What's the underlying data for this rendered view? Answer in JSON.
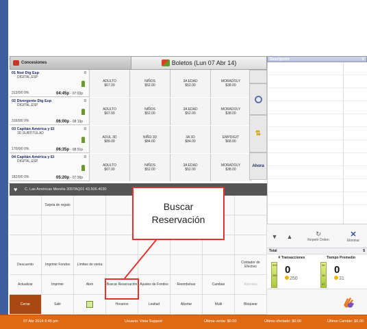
{
  "header": {
    "concessions_tab": "Concesiones",
    "tickets_title": "Boletos (Lun 07 Abr 14)"
  },
  "movies": [
    {
      "title": "01 Noé Dig Esp",
      "count": "0",
      "format": "DIGITAL,ESP",
      "seats": "313/0/0  0%",
      "time": "04:45p",
      "end_time": "- 07:03p",
      "prices": [
        {
          "label": "ADULTO",
          "value": "$67.00"
        },
        {
          "label": "NIÑOS",
          "value": "$52.00"
        },
        {
          "label": "3A EDAD",
          "value": "$52.00"
        },
        {
          "label": "MORADOLY",
          "value": "$38.00"
        }
      ]
    },
    {
      "title": "02 Divergente Dig Esp",
      "count": "0",
      "format": "DIGITAL,ESP",
      "seats": "316/0/0  0%",
      "time": "06:00p",
      "end_time": "- 08:19p",
      "prices": [
        {
          "label": "ADULTO",
          "value": "$67.00"
        },
        {
          "label": "NIÑOS",
          "value": "$52.00"
        },
        {
          "label": "3A EDAD",
          "value": "$52.00"
        },
        {
          "label": "MORADOLY",
          "value": "$38.00"
        }
      ]
    },
    {
      "title": "03 Capitán América y El",
      "count": "0",
      "format": "3D,SUBTITULAD",
      "seats": "170/0/0  0%",
      "time": "06:35p",
      "end_time": "- 08:51p",
      "prices": [
        {
          "label": "ADUL 3D",
          "value": "$89.00"
        },
        {
          "label": "NIÑO 3D",
          "value": "$84.00"
        },
        {
          "label": "3A 3D",
          "value": "$84.00"
        },
        {
          "label": "EMPDIGIT",
          "value": "$68.00"
        }
      ]
    },
    {
      "title": "04 Capitán América y El",
      "count": "0",
      "format": "DIGITAL,ESP",
      "seats": "182/0/0  0%",
      "time": "05:20p",
      "end_time": "- 07:36p",
      "prices": [
        {
          "label": "ADULTO",
          "value": "$67.00"
        },
        {
          "label": "NIÑOS",
          "value": "$52.00"
        },
        {
          "label": "3A EDAD",
          "value": "$52.00"
        },
        {
          "label": "MORADOLY",
          "value": "$38.00"
        }
      ]
    }
  ],
  "side": {
    "now_label": "Ahora"
  },
  "theater": {
    "text": "C. Las Américas Morelia  305TAQ01  43.506.4030"
  },
  "grid": {
    "row1": [
      "",
      "Tarjeta de regalo"
    ],
    "row4": [
      "Descuento",
      "Imprimir Fondos",
      "Límites de venta",
      "Contador de Efectivo"
    ],
    "row5": [
      "Actualizar",
      "Imprimir",
      "Abrir",
      "Buscar Reservación",
      "Ajustes de Fondos",
      "Reembolsar",
      "Cambiar",
      "Asientos"
    ],
    "row6": [
      "Cerrar",
      "Salir",
      "",
      "Horarios",
      "Lealtad",
      "Abortar",
      "Multi",
      "Bloquear"
    ]
  },
  "callout": {
    "line1": "Buscar",
    "line2": "Reservación"
  },
  "right_panel": {
    "col_description": "Descripción",
    "col_v": "V",
    "repeat_label": "Repetir Orden",
    "delete_label": "Eliminar",
    "total_label": "Total",
    "total_value": "$",
    "transactions_label": "# Transacciones",
    "transactions_value": "0",
    "transactions_sub": "250",
    "avg_time_label": "Tiempo Promedio",
    "avg_time_value": "0",
    "avg_time_sub": "31",
    "gauge1_top": "500",
    "gauge1_mid": "250",
    "gauge2_top": "36",
    "gauge2_mid": "18",
    "gauge2_bot": "37"
  },
  "status": {
    "datetime": "07 Abr 2014 6:45 pm",
    "user": "Usuario: Vista Support",
    "last_sale": "Última venta: $0.00",
    "last_offered": "Último ofertado: $0.00",
    "last_change": "Último Cambio: $0.00"
  },
  "colors": {
    "accent_blue": "#3e5f9d",
    "status_orange": "#e06a14",
    "callout_red": "#e53030"
  }
}
